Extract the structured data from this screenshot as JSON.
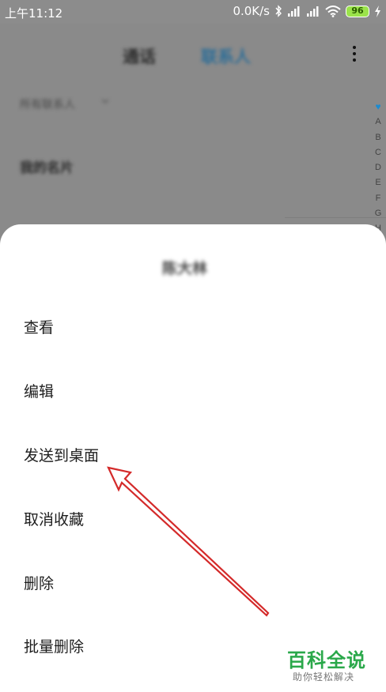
{
  "status_bar": {
    "time": "上午11:12",
    "network_speed": "0.0K/s",
    "battery": "96",
    "icons": [
      "bluetooth-icon",
      "signal-icon",
      "signal-icon",
      "wifi-icon",
      "battery-icon",
      "charging-icon"
    ]
  },
  "background": {
    "tabs": [
      "通话",
      "联系人"
    ],
    "active_tab": "联系人",
    "account_selector": "所有联系人",
    "my_card": "我的名片",
    "index_letters": [
      "A",
      "B",
      "C",
      "D",
      "E",
      "F",
      "G",
      "H"
    ]
  },
  "sheet": {
    "title": "陈大林",
    "menu_items": [
      "查看",
      "编辑",
      "发送到桌面",
      "取消收藏",
      "删除",
      "批量删除"
    ]
  },
  "watermark": {
    "main": "百科全说",
    "sub": "助你轻松解决"
  },
  "colors": {
    "accent": "#2f6e97",
    "annotation_arrow": "#d42a2a",
    "watermark": "#2aa84a"
  }
}
